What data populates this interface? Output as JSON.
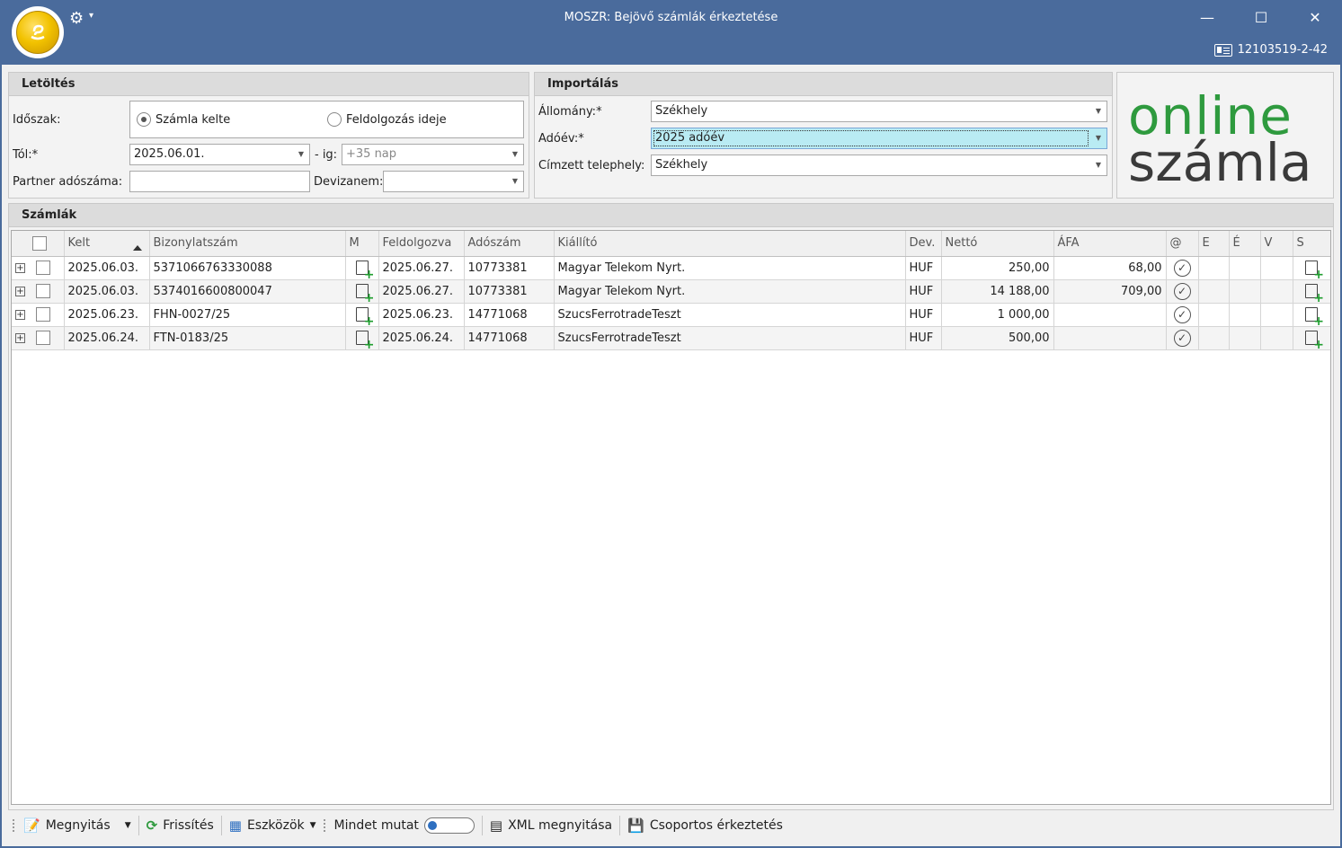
{
  "window": {
    "title": "MOSZR: Bejövő számlák érkeztetése",
    "tax_id": "12103519-2-42",
    "minimize": "—",
    "maximize": "☐",
    "close": "✕"
  },
  "letoltes": {
    "header": "Letöltés",
    "idoszak_label": "Időszak:",
    "radio_szamla_kelte": "Számla kelte",
    "radio_feldolgozas": "Feldolgozás ideje",
    "tol_label": "Tól:*",
    "tol_value": "2025.06.01.",
    "ig_label": "- ig:",
    "ig_value": "+35 nap",
    "partner_label": "Partner adószáma:",
    "partner_value": "",
    "devizanem_label": "Devizanem:",
    "devizanem_value": ""
  },
  "importalas": {
    "header": "Importálás",
    "allomany_label": "Állomány:*",
    "allomany_value": "Székhely",
    "adoev_label": "Adóév:*",
    "adoev_value": "2025 adóév",
    "telephely_label": "Címzett telephely:",
    "telephely_value": "Székhely"
  },
  "brand": {
    "line1": "online",
    "line2": "számla"
  },
  "szamlak": {
    "header": "Számlák",
    "columns": {
      "kelt": "Kelt",
      "bizonylatszam": "Bizonylatszám",
      "m": "M",
      "feldolgozva": "Feldolgozva",
      "adoszam": "Adószám",
      "kiallito": "Kiállító",
      "dev": "Dev.",
      "netto": "Nettó",
      "afa": "ÁFA",
      "at": "@",
      "e": "E",
      "e2": "É",
      "v": "V",
      "s": "S"
    },
    "rows": [
      {
        "kelt": "2025.06.03.",
        "bizonylatszam": "5371066763330088",
        "feldolgozva": "2025.06.27.",
        "adoszam": "10773381",
        "kiallito": "Magyar Telekom Nyrt.",
        "dev": "HUF",
        "netto": "250,00",
        "afa": "68,00"
      },
      {
        "kelt": "2025.06.03.",
        "bizonylatszam": "5374016600800047",
        "feldolgozva": "2025.06.27.",
        "adoszam": "10773381",
        "kiallito": "Magyar Telekom Nyrt.",
        "dev": "HUF",
        "netto": "14 188,00",
        "afa": "709,00"
      },
      {
        "kelt": "2025.06.23.",
        "bizonylatszam": "FHN-0027/25",
        "feldolgozva": "2025.06.23.",
        "adoszam": "14771068",
        "kiallito": "SzucsFerrotradeTeszt",
        "dev": "HUF",
        "netto": "1 000,00",
        "afa": ""
      },
      {
        "kelt": "2025.06.24.",
        "bizonylatszam": "FTN-0183/25",
        "feldolgozva": "2025.06.24.",
        "adoszam": "14771068",
        "kiallito": "SzucsFerrotradeTeszt",
        "dev": "HUF",
        "netto": "500,00",
        "afa": ""
      }
    ]
  },
  "toolbar": {
    "megnyitas": "Megnyitás",
    "frissites": "Frissítés",
    "eszkozok": "Eszközök",
    "mindet_mutat": "Mindet mutat",
    "xml_megnyitasa": "XML megnyitása",
    "csoportos": "Csoportos érkeztetés"
  },
  "colors": {
    "titlebar": "#4a6b9c",
    "brand_green": "#2e9a3e",
    "brand_dark": "#3a3a3a"
  }
}
